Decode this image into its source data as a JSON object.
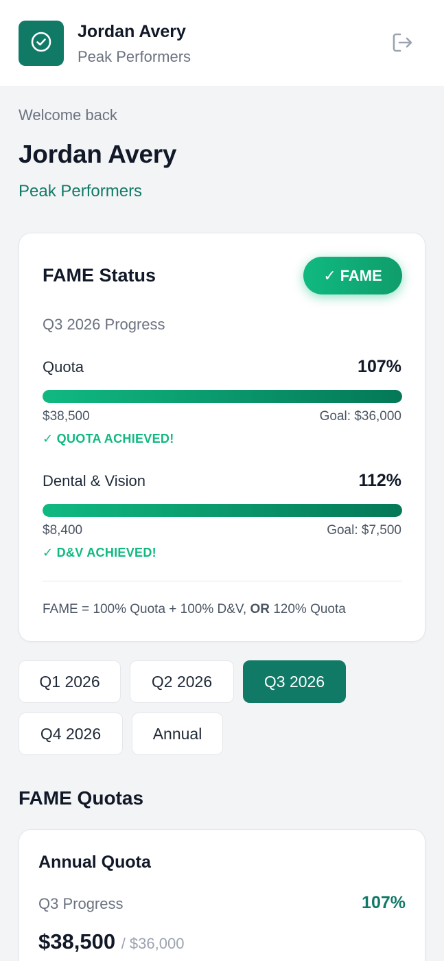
{
  "header": {
    "name": "Jordan Avery",
    "team": "Peak Performers",
    "logo_icon": "check-circle-icon",
    "logout_icon": "logout-icon"
  },
  "welcome": {
    "greeting": "Welcome back",
    "name": "Jordan Avery",
    "team": "Peak Performers"
  },
  "fame": {
    "title": "FAME Status",
    "badge_check": "✓",
    "badge_label": "FAME",
    "period": "Q3 2026 Progress",
    "metrics": [
      {
        "label": "Quota",
        "pct": "107%",
        "value": "$38,500",
        "goal": "Goal: $36,000",
        "status": "✓ QUOTA ACHIEVED!",
        "fill": 1.0
      },
      {
        "label": "Dental & Vision",
        "pct": "112%",
        "value": "$8,400",
        "goal": "Goal: $7,500",
        "status": "✓ D&V ACHIEVED!",
        "fill": 1.0
      }
    ],
    "formula_part1": "FAME = 100% Quota + 100% D&V, ",
    "formula_or": "OR",
    "formula_part2": " 120% Quota"
  },
  "tabs": [
    {
      "label": "Q1 2026",
      "active": false
    },
    {
      "label": "Q2 2026",
      "active": false
    },
    {
      "label": "Q3 2026",
      "active": true
    },
    {
      "label": "Q4 2026",
      "active": false
    },
    {
      "label": "Annual",
      "active": false
    }
  ],
  "quotas_section": {
    "title": "FAME Quotas",
    "card": {
      "title": "Annual Quota",
      "progress_label": "Q3 Progress",
      "progress_pct": "107%",
      "amount": "$38,500",
      "goal": "/ $36,000"
    }
  },
  "colors": {
    "brand": "#117a67",
    "success": "#10b981",
    "background": "#f3f4f6"
  }
}
